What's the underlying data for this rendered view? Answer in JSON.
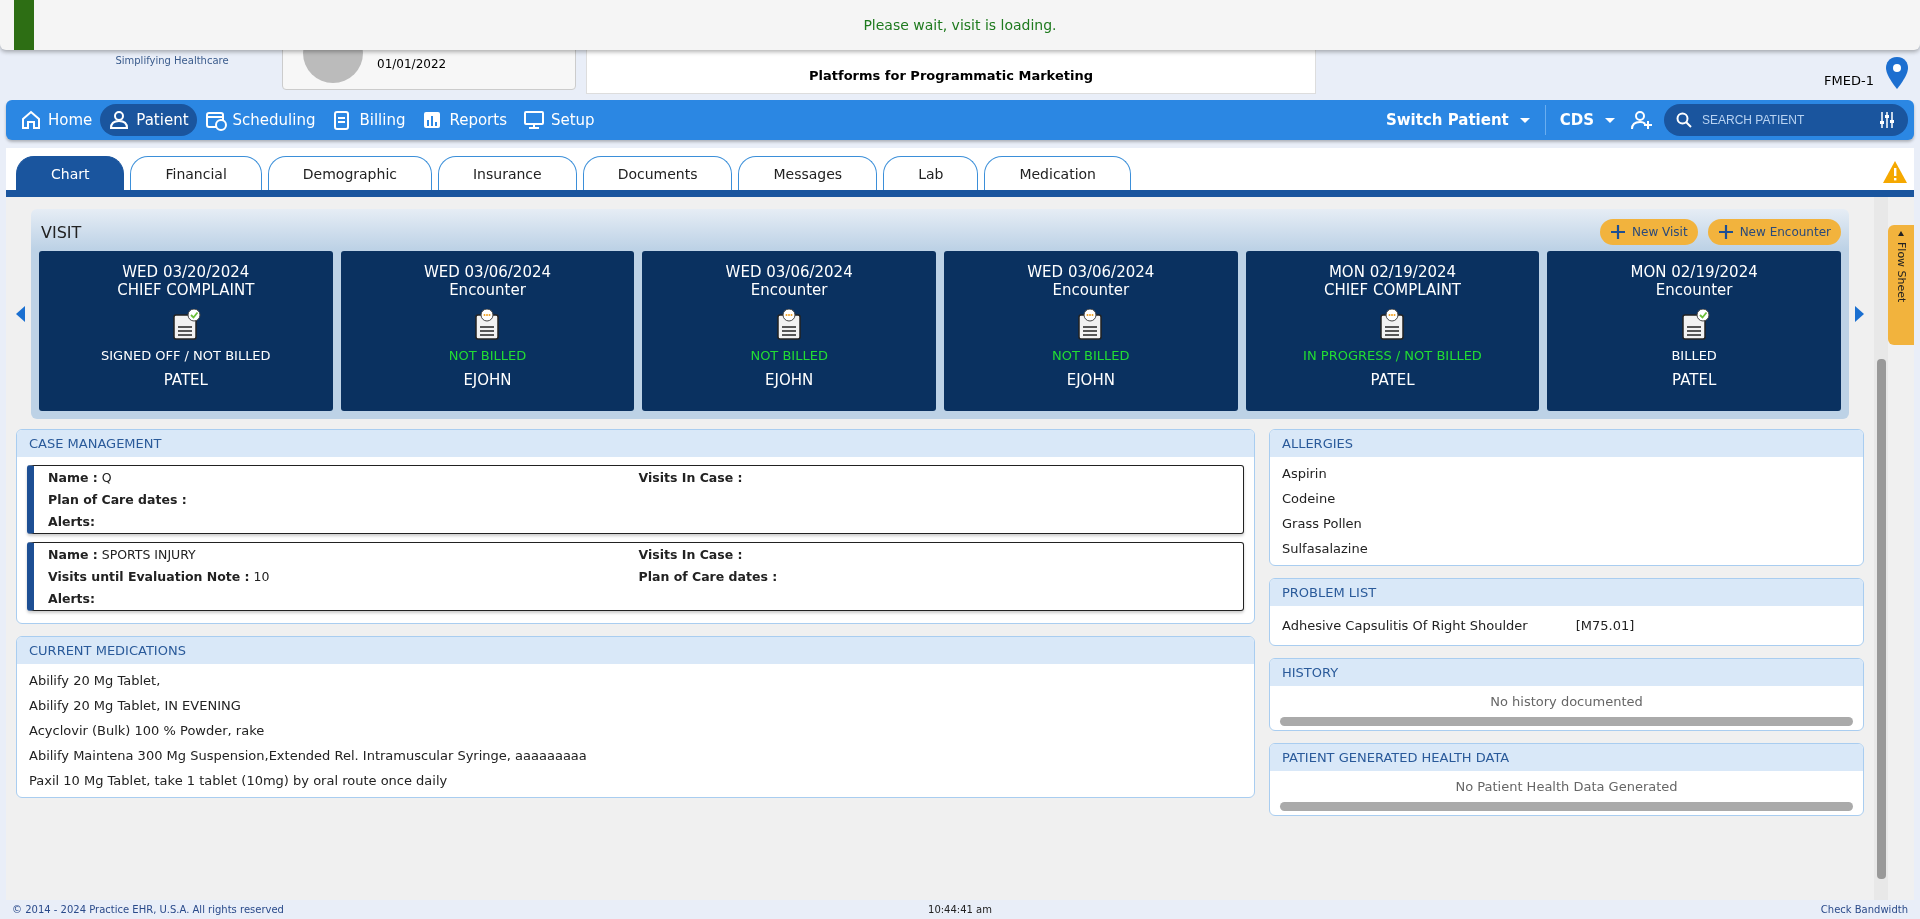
{
  "loading_banner": {
    "message": "Please wait, visit is loading."
  },
  "header": {
    "logo_tagline": "Simplifying Healthcare",
    "patient_dob": "01/01/2022",
    "ad_text": "Platforms for Programmatic Marketing",
    "facility": "FMED-1"
  },
  "nav": {
    "items": [
      {
        "label": "Home",
        "selected": false
      },
      {
        "label": "Patient",
        "selected": true
      },
      {
        "label": "Scheduling",
        "selected": false
      },
      {
        "label": "Billing",
        "selected": false
      },
      {
        "label": "Reports",
        "selected": false
      },
      {
        "label": "Setup",
        "selected": false
      }
    ],
    "switch_patient": "Switch Patient",
    "cds": "CDS",
    "search": {
      "placeholder": "SEARCH PATIENT"
    }
  },
  "tabs": [
    {
      "label": "Chart",
      "selected": true
    },
    {
      "label": "Financial",
      "selected": false
    },
    {
      "label": "Demographic",
      "selected": false
    },
    {
      "label": "Insurance",
      "selected": false
    },
    {
      "label": "Documents",
      "selected": false
    },
    {
      "label": "Messages",
      "selected": false
    },
    {
      "label": "Lab",
      "selected": false
    },
    {
      "label": "Medication",
      "selected": false
    }
  ],
  "visit": {
    "title": "VISIT",
    "buttons": [
      "New Visit",
      "New Encounter"
    ],
    "cards": [
      {
        "date": "WED 03/20/2024",
        "type": "CHIEF COMPLAINT",
        "kind": "signed",
        "status": "SIGNED OFF / NOT BILLED",
        "color": "#ffffff",
        "provider": "PATEL"
      },
      {
        "date": "WED 03/06/2024",
        "type": "Encounter",
        "kind": "pending",
        "status": "NOT BILLED",
        "color": "#22dd33",
        "provider": "EJOHN"
      },
      {
        "date": "WED 03/06/2024",
        "type": "Encounter",
        "kind": "pending",
        "status": "NOT BILLED",
        "color": "#22dd33",
        "provider": "EJOHN"
      },
      {
        "date": "WED 03/06/2024",
        "type": "Encounter",
        "kind": "pending",
        "status": "NOT BILLED",
        "color": "#22dd33",
        "provider": "EJOHN"
      },
      {
        "date": "MON 02/19/2024",
        "type": "CHIEF COMPLAINT",
        "kind": "pending",
        "status": "IN PROGRESS / NOT BILLED",
        "color": "#22dd33",
        "provider": "PATEL"
      },
      {
        "date": "MON 02/19/2024",
        "type": "Encounter",
        "kind": "signed",
        "status": "BILLED",
        "color": "#ffffff",
        "provider": "PATEL"
      }
    ]
  },
  "flow_sheet": "Flow Sheet",
  "case_management": {
    "title": "CASE MANAGEMENT",
    "cases": [
      {
        "rows": [
          [
            {
              "label": "Name :",
              "value": "Q"
            },
            {
              "label": "Visits In Case :"
            }
          ],
          [
            {
              "label": "Plan of Care dates :"
            }
          ],
          [
            {
              "label": "Alerts:"
            }
          ]
        ]
      },
      {
        "rows": [
          [
            {
              "label": "Name :",
              "value": "SPORTS INJURY"
            },
            {
              "label": "Visits In Case :"
            }
          ],
          [
            {
              "label": "Visits until Evaluation Note :",
              "value": "10"
            },
            {
              "label": "Plan of Care dates :"
            }
          ],
          [
            {
              "label": "Alerts:"
            }
          ]
        ]
      }
    ]
  },
  "current_medications": {
    "title": "CURRENT MEDICATIONS",
    "items": [
      "Abilify 20 Mg Tablet,",
      "Abilify 20 Mg Tablet, IN EVENING",
      "Acyclovir (Bulk) 100 % Powder, rake",
      "Abilify Maintena 300 Mg Suspension,Extended Rel. Intramuscular Syringe, aaaaaaaaa",
      "Paxil 10 Mg Tablet, take 1 tablet (10mg) by oral route once daily"
    ]
  },
  "allergies": {
    "title": "ALLERGIES",
    "items": [
      "Aspirin",
      "Codeine",
      "Grass Pollen",
      "Sulfasalazine"
    ]
  },
  "problem_list": {
    "title": "PROBLEM LIST",
    "items": [
      {
        "name": "Adhesive Capsulitis Of Right Shoulder",
        "code": "[M75.01]"
      }
    ]
  },
  "history": {
    "title": "HISTORY",
    "empty": "No history documented"
  },
  "health_data": {
    "title": "PATIENT GENERATED HEALTH DATA",
    "empty": "No Patient Health Data Generated"
  },
  "footer": {
    "copyright": "© 2014 - 2024 Practice EHR, U.S.A. All rights reserved",
    "time": "10:44:41 am",
    "link": "Check Bandwidth"
  }
}
